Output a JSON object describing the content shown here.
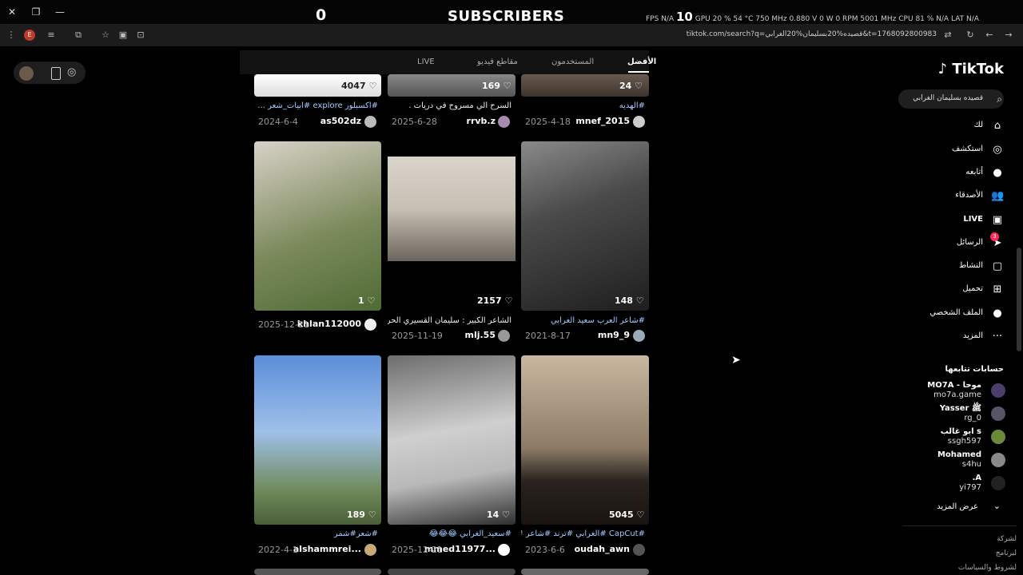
{
  "overlay": {
    "subscriber_count": "0",
    "subscriber_label": "SUBSCRIBERS",
    "fps_label": "FPS",
    "fps_value": "N/A",
    "big_value": "10",
    "gpu_label": "GPU",
    "gpu_stats": "20 % 54 °C 750 MHz 0.880 V 0 W 0 RPM 5001 MHz",
    "cpu_label": "CPU",
    "cpu_stats": "81 % N/A",
    "lat_label": "LAT",
    "lat_value": "N/A"
  },
  "browser": {
    "url": "tiktok.com/search?q=قصيده%20بسليمان%20الغرابي&t=1768092800983"
  },
  "tabs": [
    {
      "label": "الأفضل",
      "active": true
    },
    {
      "label": "المستخدمون",
      "active": false
    },
    {
      "label": "مقاطع فيديو",
      "active": false
    },
    {
      "label": "LIVE",
      "active": false
    }
  ],
  "rows": [
    [
      {
        "likes": "24",
        "caption": "#الهديه",
        "user": "mnef_2015",
        "date": "2025-4-18"
      },
      {
        "likes": "169",
        "caption": "السرح الي مسروح في دريات .",
        "user": "rrvb.z",
        "date": "2025-6-28"
      },
      {
        "likes": "4047",
        "caption": "#اكسبلور explore #ابيات_شعر ...",
        "user": "as502dz",
        "date": "2024-6-4"
      }
    ],
    [
      {
        "likes": "148",
        "caption": "#شاعر العرب سعيد الغرابي",
        "user": "mn9_9",
        "date": "2021-8-17"
      },
      {
        "likes": "2157",
        "caption": "الشاعر الكبير : سليمان القسيري الحربي ...",
        "user": "mlj.55",
        "date": "2025-11-19"
      },
      {
        "likes": "1",
        "caption": "",
        "user": "khlan112000",
        "date": "2025-12-21"
      }
    ],
    [
      {
        "likes": "5045",
        "caption": "#CapCut #الغرابي #ترند #شاعر #",
        "user": "oudah_awn",
        "date": "2023-6-6"
      },
      {
        "likes": "14",
        "caption": "#سعيد_الغرابي 😂😂😂",
        "user": "mmed11977...",
        "date": "2025-12-21"
      },
      {
        "likes": "189",
        "caption": "#شعر#شمر",
        "user": "alshammrei...",
        "date": "2022-4-1"
      }
    ]
  ],
  "sidebar": {
    "logo": "TikTok",
    "search_value": "قصيده بسليمان الغرابي",
    "nav": [
      {
        "label": "لك",
        "icon": "home-icon",
        "glyph": "⌂"
      },
      {
        "label": "استكشف",
        "icon": "compass-icon",
        "glyph": "◎"
      },
      {
        "label": "أتابعه",
        "icon": "following-icon",
        "glyph": "●"
      },
      {
        "label": "الأصدقاء",
        "icon": "friends-icon",
        "glyph": "👥"
      },
      {
        "label": "LIVE",
        "icon": "live-icon",
        "glyph": "▣"
      },
      {
        "label": "الرسائل",
        "icon": "messages-icon",
        "glyph": "➤",
        "badge": "3"
      },
      {
        "label": "النشاط",
        "icon": "activity-icon",
        "glyph": "▢"
      },
      {
        "label": "تحميل",
        "icon": "upload-icon",
        "glyph": "⊞"
      },
      {
        "label": "الملف الشخصي",
        "icon": "profile-icon",
        "glyph": "●"
      },
      {
        "label": "المزيد",
        "icon": "more-icon",
        "glyph": "···"
      }
    ],
    "following_title": "حسابات تتابعها",
    "following": [
      {
        "name": "MO7A - موحا",
        "handle": "mo7a.game"
      },
      {
        "name": "Yasser ﷺ",
        "handle": "rg_0"
      },
      {
        "name": "ابو غالب s",
        "handle": "ssgh597"
      },
      {
        "name": "Mohamed",
        "handle": "s4hu"
      },
      {
        "name": ".A",
        "handle": "yi797"
      }
    ],
    "see_more": "عرض المزيد",
    "footer": [
      "لشركة",
      "لبرنامج",
      "لشروط والسياسات"
    ]
  }
}
